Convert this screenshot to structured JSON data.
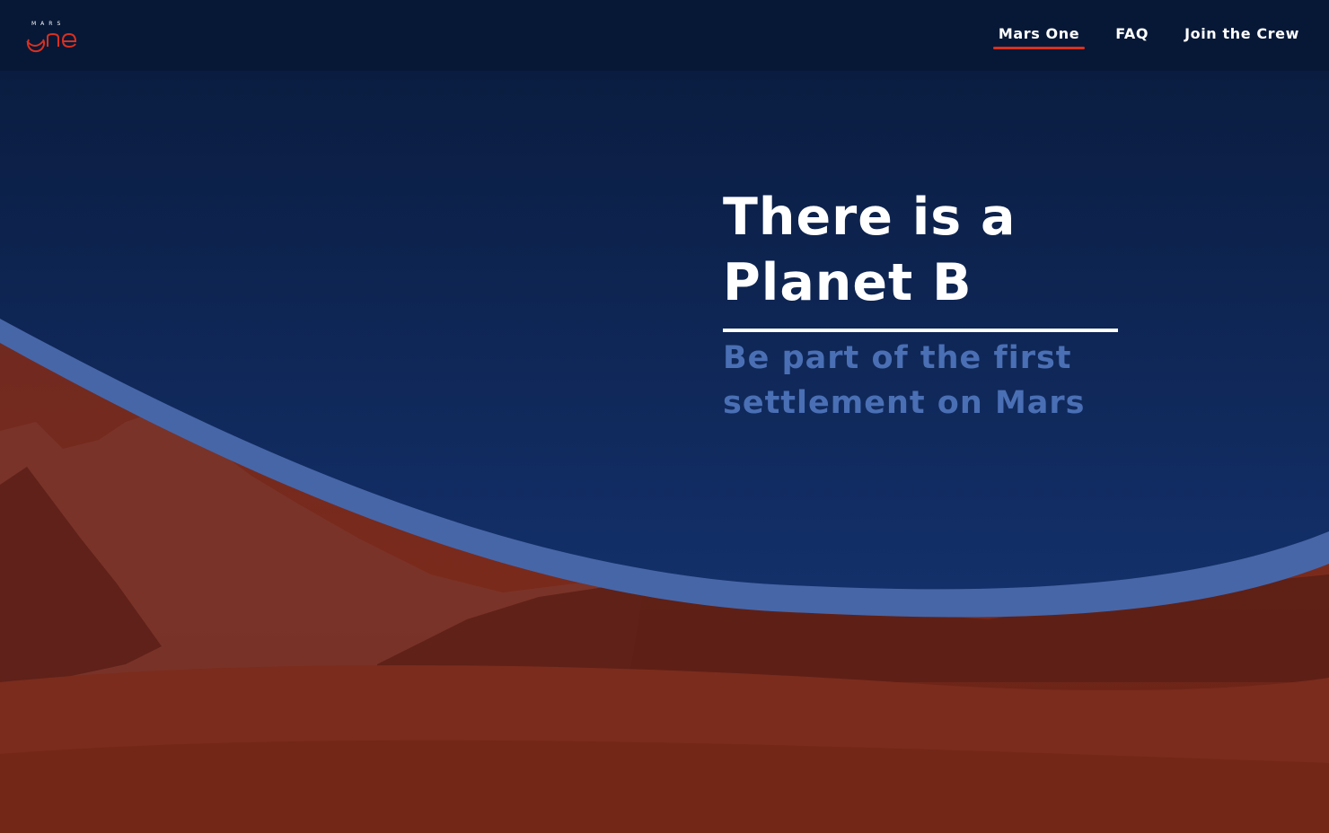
{
  "brand": {
    "logo_top": "MARS",
    "logo_main": "one",
    "accent_color": "#d9301f"
  },
  "nav": {
    "items": [
      {
        "label": "Mars One",
        "active": true
      },
      {
        "label": "FAQ",
        "active": false
      },
      {
        "label": "Join the Crew",
        "active": false
      }
    ]
  },
  "hero": {
    "title_line1": "There is a",
    "title_line2": "Planet B",
    "subtitle_line1": "Be part of the first",
    "subtitle_line2": "settlement on Mars"
  },
  "colors": {
    "sky": "#0f2a5a",
    "band": "#4766a8",
    "mars": "#7c2b1e",
    "heading": "#ffffff",
    "subheading": "#4a6fb4"
  }
}
